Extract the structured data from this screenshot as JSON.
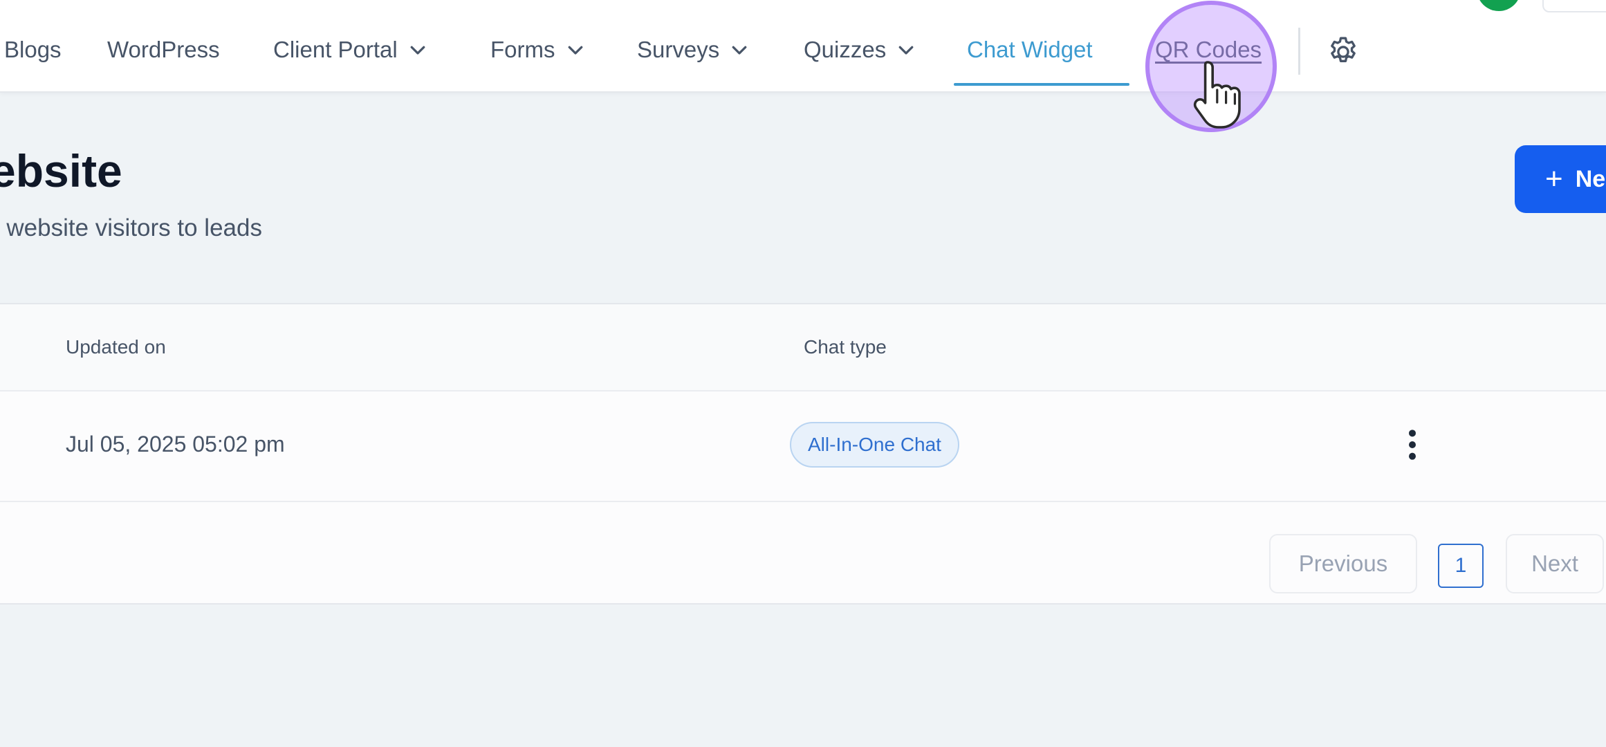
{
  "nav": {
    "items": [
      {
        "label": "Blogs",
        "has_dropdown": false
      },
      {
        "label": "WordPress",
        "has_dropdown": false
      },
      {
        "label": "Client Portal",
        "has_dropdown": true
      },
      {
        "label": "Forms",
        "has_dropdown": true
      },
      {
        "label": "Surveys",
        "has_dropdown": true
      },
      {
        "label": "Quizzes",
        "has_dropdown": true
      },
      {
        "label": "Chat Widget",
        "has_dropdown": false,
        "active": true
      },
      {
        "label": "QR Codes",
        "has_dropdown": false,
        "hovered": true
      }
    ],
    "settings_icon": "gear-icon"
  },
  "page": {
    "title": "ebsite",
    "subtitle": "r website visitors to leads",
    "new_button": {
      "icon": "plus-icon",
      "label": "Ne"
    }
  },
  "table": {
    "columns": [
      "Updated on",
      "Chat type"
    ],
    "rows": [
      {
        "updated_on": "Jul 05, 2025 05:02 pm",
        "chat_type": "All-In-One Chat",
        "actions_icon": "kebab-menu-icon"
      }
    ]
  },
  "pagination": {
    "previous_label": "Previous",
    "current_page": "1",
    "next_label": "Next"
  },
  "colors": {
    "accent": "#3d9bd0",
    "primary_button": "#155eef",
    "chip_text": "#2f6fcf",
    "background": "#eff3f6",
    "click_highlight": "#b98cff"
  }
}
